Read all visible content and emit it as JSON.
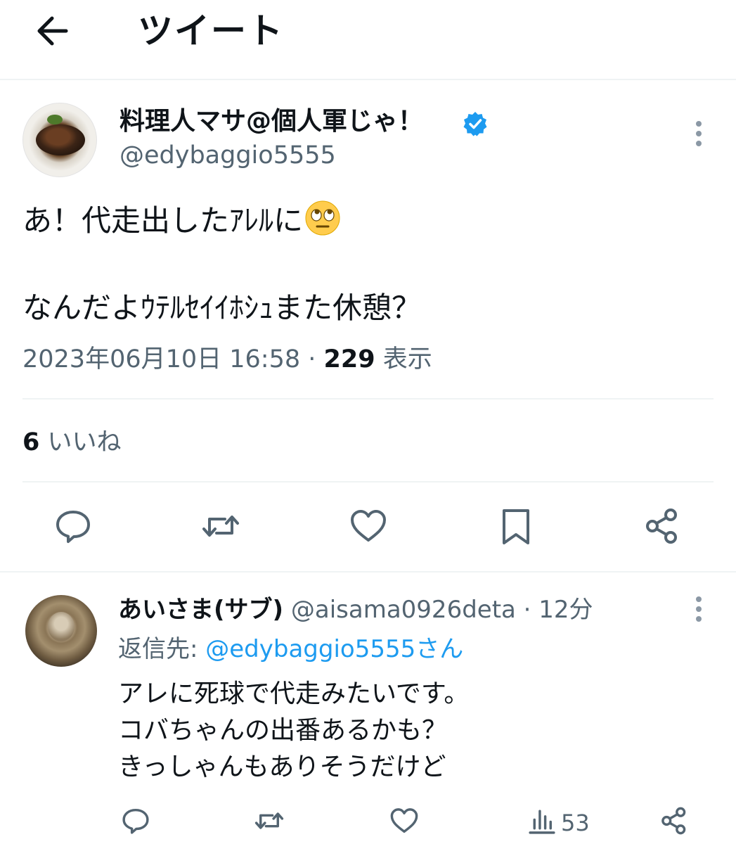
{
  "header": {
    "title": "ツイート",
    "back_icon": "arrow-left-icon"
  },
  "tweet": {
    "author": {
      "display_name": "料理人マサ@個人軍じゃ！",
      "handle": "@edybaggio5555",
      "verified": true,
      "verified_color": "#1d9bf0"
    },
    "lines": [
      "あ！代走出したｱﾚﾙに",
      "なんだよｳﾃﾙｾｲｲﾎｼｭまた休憩？"
    ],
    "emoji": "face-with-rolling-eyes",
    "timestamp": "2023年06月10日 16:58 · ",
    "views_count": "229",
    "views_label": " 表示",
    "likes_count": "6",
    "likes_label": " いいね"
  },
  "reply": {
    "author": {
      "display_name": "あいさま(サブ)",
      "handle": " @aisama0926deta · 12分"
    },
    "reply_prefix": "返信先: ",
    "reply_target": "@edybaggio5555さん",
    "lines": [
      "アレに死球で代走みたいです。",
      "コバちゃんの出番あるかも？",
      "きっしゃんもありそうだけど"
    ],
    "views": "53"
  },
  "colors": {
    "text": "#0f1419",
    "secondary": "#536471",
    "link": "#1d9bf0",
    "divider": "#eff3f4"
  }
}
